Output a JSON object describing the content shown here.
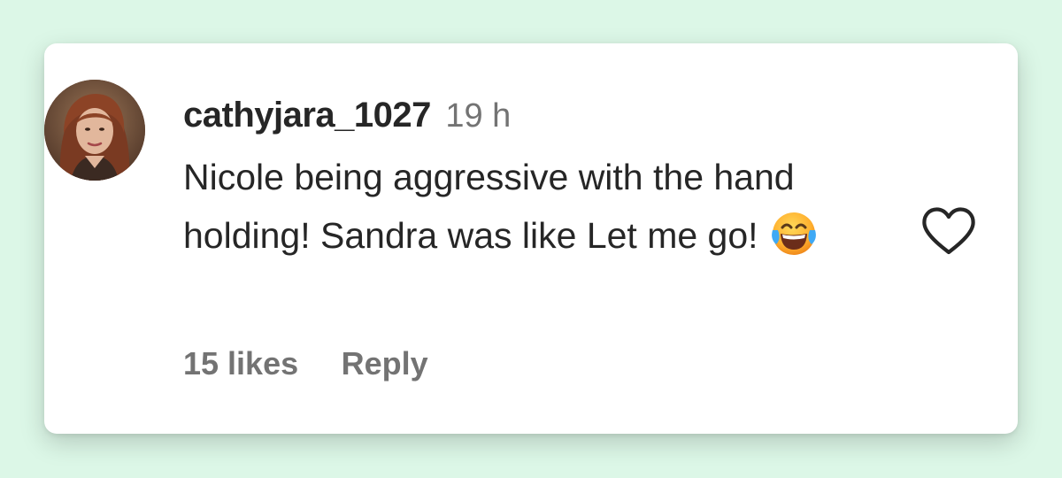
{
  "comment": {
    "username": "cathyjara_1027",
    "time": "19 h",
    "text": "Nicole being aggressive with the hand holding! Sandra was like Let me go!",
    "emoji": "face-with-tears-of-joy-icon",
    "likes": "15 likes",
    "reply_label": "Reply"
  },
  "icons": {
    "like": "heart-outline-icon",
    "avatar": "profile-photo"
  },
  "colors": {
    "page_background": "#dcf7e7",
    "card_background": "#ffffff",
    "primary_text": "#262626",
    "secondary_text": "#737373",
    "heart_stroke": "#262626"
  }
}
